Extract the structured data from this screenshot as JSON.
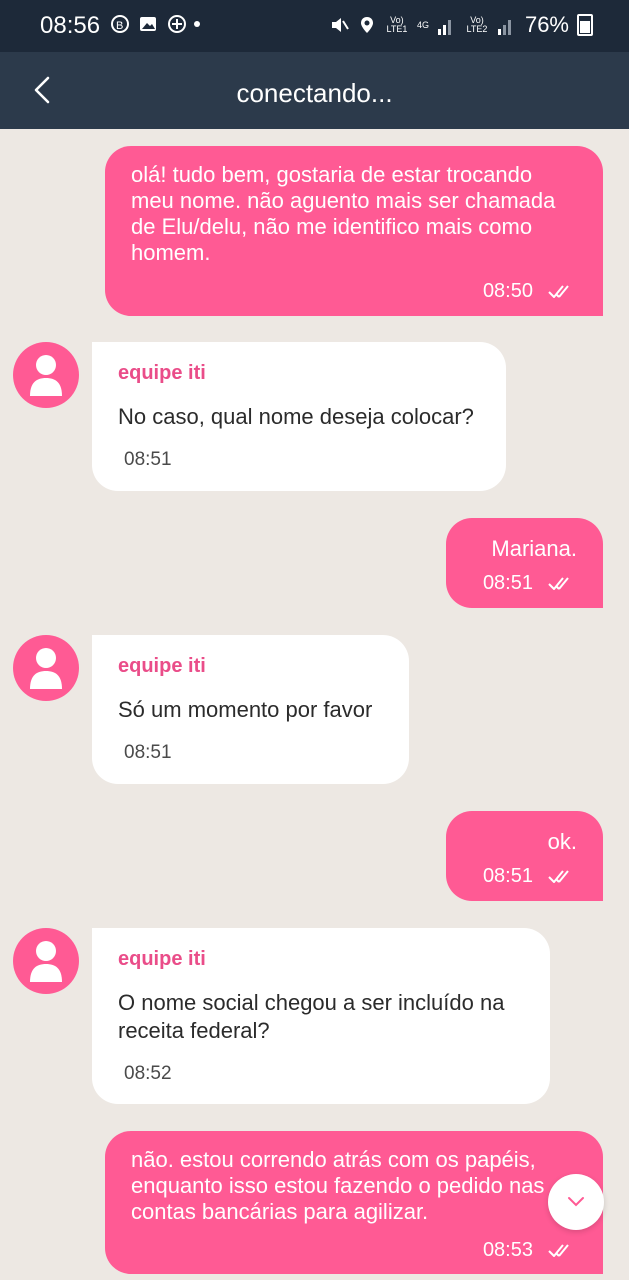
{
  "status_bar": {
    "time": "08:56",
    "battery": "76%",
    "sim1_label": "Vo) LTE1",
    "net_label": "4G",
    "sim2_label": "Vo) LTE2"
  },
  "header": {
    "title": "conectando..."
  },
  "messages": [
    {
      "direction": "out",
      "text": "olá! tudo bem, gostaria de estar trocando meu nome. não aguento mais ser chamada de Elu/delu, não me identifico mais como homem.",
      "time": "08:50"
    },
    {
      "direction": "in",
      "sender": "equipe iti",
      "text": "No caso, qual nome deseja colocar?",
      "time": "08:51"
    },
    {
      "direction": "out",
      "text": "Mariana.",
      "time": "08:51"
    },
    {
      "direction": "in",
      "sender": "equipe iti",
      "text": "Só um momento por favor",
      "time": "08:51"
    },
    {
      "direction": "out",
      "text": "ok.",
      "time": "08:51"
    },
    {
      "direction": "in",
      "sender": "equipe iti",
      "text": "O nome social chegou a ser incluído na receita federal?",
      "time": "08:52"
    },
    {
      "direction": "out",
      "text": "não. estou correndo atrás com os papéis, enquanto isso estou fazendo o pedido nas contas bancárias para agilizar.",
      "time": "08:53"
    }
  ],
  "colors": {
    "accent": "#ff5a94",
    "header": "#2c3a4b",
    "statusbar": "#1d2939",
    "background": "#ede8e3"
  }
}
